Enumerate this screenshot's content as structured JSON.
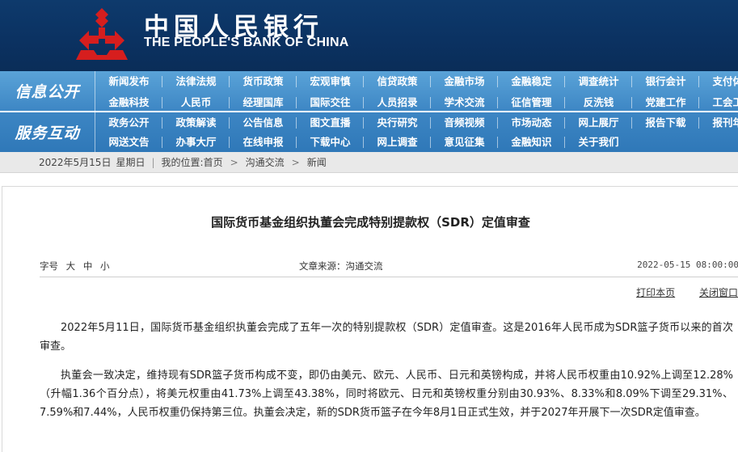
{
  "header": {
    "cn_name": "中国人民银行",
    "en_name": "THE PEOPLE'S BANK OF CHINA",
    "colors": {
      "banner": "#0e3a6c",
      "logo": "#d61e1e"
    },
    "logo_icon": "pboc-emblem-icon"
  },
  "nav": {
    "section1_label": "信息公开",
    "section2_label": "服务互动",
    "row1": [
      "新闻发布",
      "法律法规",
      "货币政策",
      "宏观审慎",
      "信贷政策",
      "金融市场",
      "金融稳定",
      "调查统计",
      "银行会计",
      "支付体系"
    ],
    "row2": [
      "金融科技",
      "人民币",
      "经理国库",
      "国际交往",
      "人员招录",
      "学术交流",
      "征信管理",
      "反洗钱",
      "党建工作",
      "工会工作"
    ],
    "row3": [
      "政务公开",
      "政策解读",
      "公告信息",
      "图文直播",
      "央行研究",
      "音频视频",
      "市场动态",
      "网上展厅",
      "报告下载",
      "报刊年鉴"
    ],
    "row4": [
      "网送文告",
      "办事大厅",
      "在线申报",
      "下载中心",
      "网上调查",
      "意见征集",
      "金融知识",
      "关于我们"
    ],
    "colors": {
      "bar": "#3d86c4",
      "text": "#ffffff"
    }
  },
  "breadcrumb": {
    "date": "2022年5月15日",
    "weekday": "星期日",
    "location_label": "我的位置:",
    "items": [
      "首页",
      "沟通交流",
      "新闻"
    ]
  },
  "article": {
    "title": "国际货币基金组织执董会完成特别提款权（SDR）定值审查",
    "font_size_label": "字号",
    "font_size_options": [
      "大",
      "中",
      "小"
    ],
    "source": "文章来源：沟通交流",
    "date": "2022-05-15 08:00:00",
    "print_label": "打印本页",
    "close_label": "关闭窗口",
    "paragraphs": [
      "2022年5月11日，国际货币基金组织执董会完成了五年一次的特别提款权（SDR）定值审查。这是2016年人民币成为SDR篮子货币以来的首次审查。",
      "执董会一致决定，维持现有SDR篮子货币构成不变，即仍由美元、欧元、人民币、日元和英镑构成，并将人民币权重由10.92%上调至12.28%（升幅1.36个百分点），将美元权重由41.73%上调至43.38%，同时将欧元、日元和英镑权重分别由30.93%、8.33%和8.09%下调至29.31%、7.59%和7.44%，人民币权重仍保持第三位。执董会决定，新的SDR货币篮子在今年8月1日正式生效，并于2027年开展下一次SDR定值审查。"
    ]
  }
}
